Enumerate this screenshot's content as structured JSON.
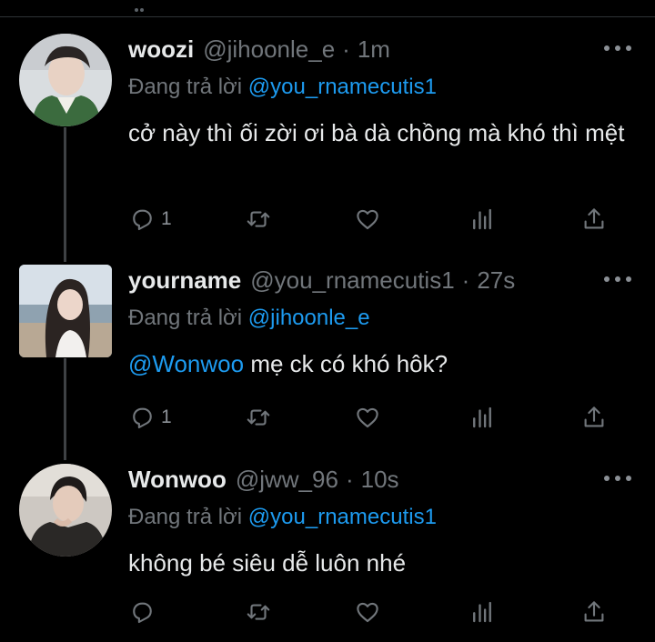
{
  "tweets": [
    {
      "name": "woozi",
      "handle": "@jihoonle_e",
      "time": "1m",
      "replying_label": "Đang trả lời ",
      "replying_to": "@you_rnamecutis1",
      "body_mention": "",
      "body_text": "cở này thì ối zời ơi bà dà chồng mà khó thì mệt",
      "reply_count": "1",
      "avatar_icon": "avatar-photo-woozi"
    },
    {
      "name": "yourname",
      "handle": "@you_rnamecutis1",
      "time": "27s",
      "replying_label": "Đang trả lời ",
      "replying_to": "@jihoonle_e",
      "body_mention": "@Wonwoo",
      "body_text": " mẹ ck có khó hôk?",
      "reply_count": "1",
      "avatar_icon": "avatar-photo-yourname"
    },
    {
      "name": "Wonwoo",
      "handle": "@jww_96",
      "time": "10s",
      "replying_label": "Đang trả lời ",
      "replying_to": "@you_rnamecutis1",
      "body_mention": "",
      "body_text": "không bé siêu dễ luôn nhé",
      "reply_count": "",
      "avatar_icon": "avatar-photo-wonwoo"
    }
  ],
  "separator": "·",
  "icons": {
    "reply": "reply-icon",
    "retweet": "retweet-icon",
    "like": "like-icon",
    "views": "views-icon",
    "share": "share-icon",
    "more": "more-icon"
  },
  "colors": {
    "background": "#000000",
    "text": "#e7e9ea",
    "secondary": "#71767b",
    "accent": "#1d9bf0",
    "thread_line": "#3e4144"
  }
}
